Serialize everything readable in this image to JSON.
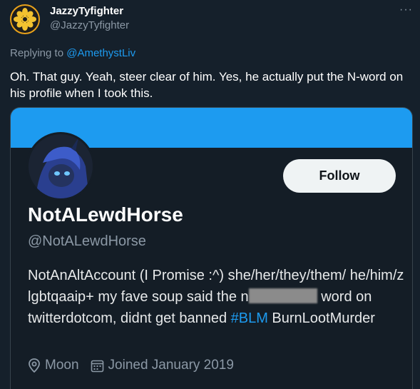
{
  "tweet": {
    "author_display_name": "JazzyTyfighter",
    "author_handle": "@JazzyTyfighter",
    "more_label": "···",
    "replying_prefix": "Replying to",
    "replying_to": "@AmethystLiv",
    "text": "Oh. That guy. Yeah, steer clear of him. Yes, he actually put the N-word on his profile when I took this."
  },
  "screenshot_profile": {
    "follow_label": "Follow",
    "display_name": "NotALewdHorse",
    "handle": "@NotALewdHorse",
    "bio_part1": "NotAnAltAccount (I Promise :^) she/her/they/them/ he/him/z lgbtqaaip+ my fave soup said the n",
    "bio_part2": " word on twitterdotcom, didnt get banned ",
    "bio_hashtag": "#BLM",
    "bio_part3": " BurnLootMurder",
    "location": "Moon",
    "joined": "Joined January 2019"
  },
  "colors": {
    "background": "#15202b",
    "accent": "#1d9bf0",
    "avatar_border": "#e9a21a"
  },
  "icons": {
    "location": "location-pin-icon",
    "calendar": "calendar-icon",
    "more": "more-dots-icon"
  }
}
